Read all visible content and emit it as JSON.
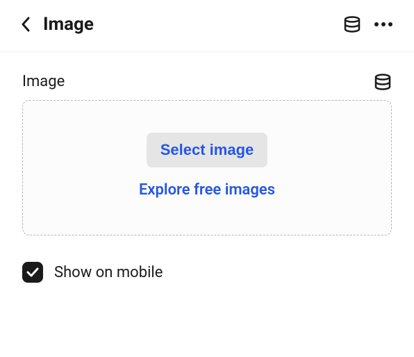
{
  "header": {
    "title": "Image"
  },
  "main": {
    "field_label": "Image",
    "select_image_label": "Select image",
    "explore_label": "Explore free images",
    "show_on_mobile_label": "Show on mobile",
    "show_on_mobile_checked": true
  }
}
